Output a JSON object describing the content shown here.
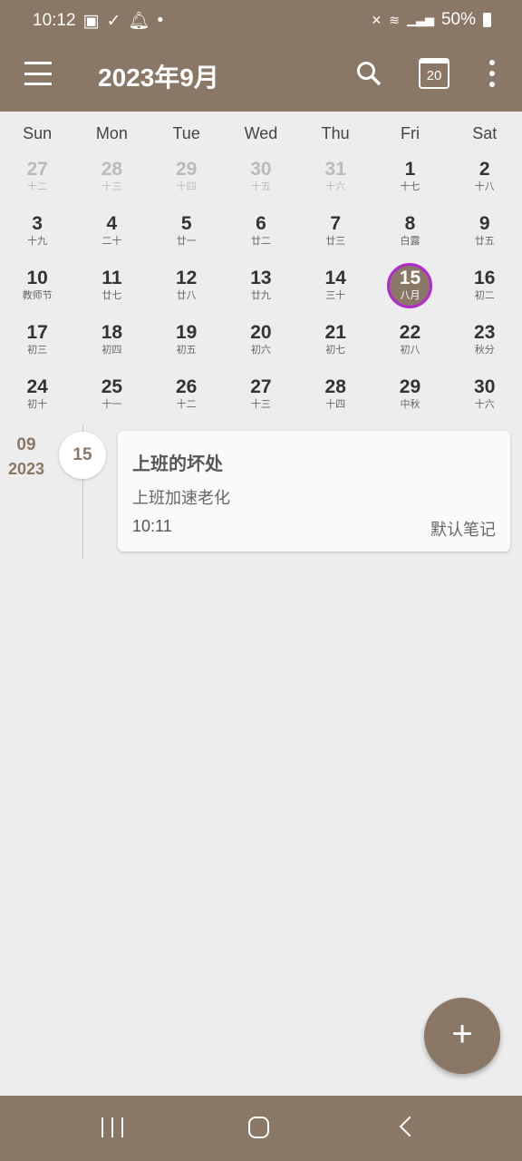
{
  "status_bar": {
    "time": "10:12",
    "battery": "50%",
    "icons": [
      "image-icon",
      "check-icon",
      "bell-icon",
      "dot-icon",
      "mute-icon",
      "wifi-icon",
      "signal-icon",
      "battery-icon"
    ]
  },
  "header": {
    "title": "2023年9月",
    "calendar_badge": "20"
  },
  "colors": {
    "primary": "#8b7765",
    "selected_ring": "#b02ad0"
  },
  "weekdays": [
    "Sun",
    "Mon",
    "Tue",
    "Wed",
    "Thu",
    "Fri",
    "Sat"
  ],
  "weeks": [
    [
      {
        "d": "27",
        "l": "十二",
        "o": 1
      },
      {
        "d": "28",
        "l": "十三",
        "o": 1
      },
      {
        "d": "29",
        "l": "十四",
        "o": 1
      },
      {
        "d": "30",
        "l": "十五",
        "o": 1
      },
      {
        "d": "31",
        "l": "十六",
        "o": 1
      },
      {
        "d": "1",
        "l": "十七"
      },
      {
        "d": "2",
        "l": "十八"
      }
    ],
    [
      {
        "d": "3",
        "l": "十九"
      },
      {
        "d": "4",
        "l": "二十"
      },
      {
        "d": "5",
        "l": "廿一"
      },
      {
        "d": "6",
        "l": "廿二"
      },
      {
        "d": "7",
        "l": "廿三"
      },
      {
        "d": "8",
        "l": "白露"
      },
      {
        "d": "9",
        "l": "廿五"
      }
    ],
    [
      {
        "d": "10",
        "l": "教师节"
      },
      {
        "d": "11",
        "l": "廿七"
      },
      {
        "d": "12",
        "l": "廿八"
      },
      {
        "d": "13",
        "l": "廿九"
      },
      {
        "d": "14",
        "l": "三十"
      },
      {
        "d": "15",
        "l": "八月",
        "s": 1
      },
      {
        "d": "16",
        "l": "初二"
      }
    ],
    [
      {
        "d": "17",
        "l": "初三"
      },
      {
        "d": "18",
        "l": "初四"
      },
      {
        "d": "19",
        "l": "初五"
      },
      {
        "d": "20",
        "l": "初六"
      },
      {
        "d": "21",
        "l": "初七"
      },
      {
        "d": "22",
        "l": "初八"
      },
      {
        "d": "23",
        "l": "秋分"
      }
    ],
    [
      {
        "d": "24",
        "l": "初十"
      },
      {
        "d": "25",
        "l": "十一"
      },
      {
        "d": "26",
        "l": "十二"
      },
      {
        "d": "27",
        "l": "十三"
      },
      {
        "d": "28",
        "l": "十四"
      },
      {
        "d": "29",
        "l": "中秋"
      },
      {
        "d": "30",
        "l": "十六"
      }
    ]
  ],
  "entry": {
    "month": "09",
    "year": "2023",
    "day": "15",
    "title": "上班的坏处",
    "body": "上班加速老化",
    "time": "10:11",
    "notebook": "默认笔记"
  }
}
